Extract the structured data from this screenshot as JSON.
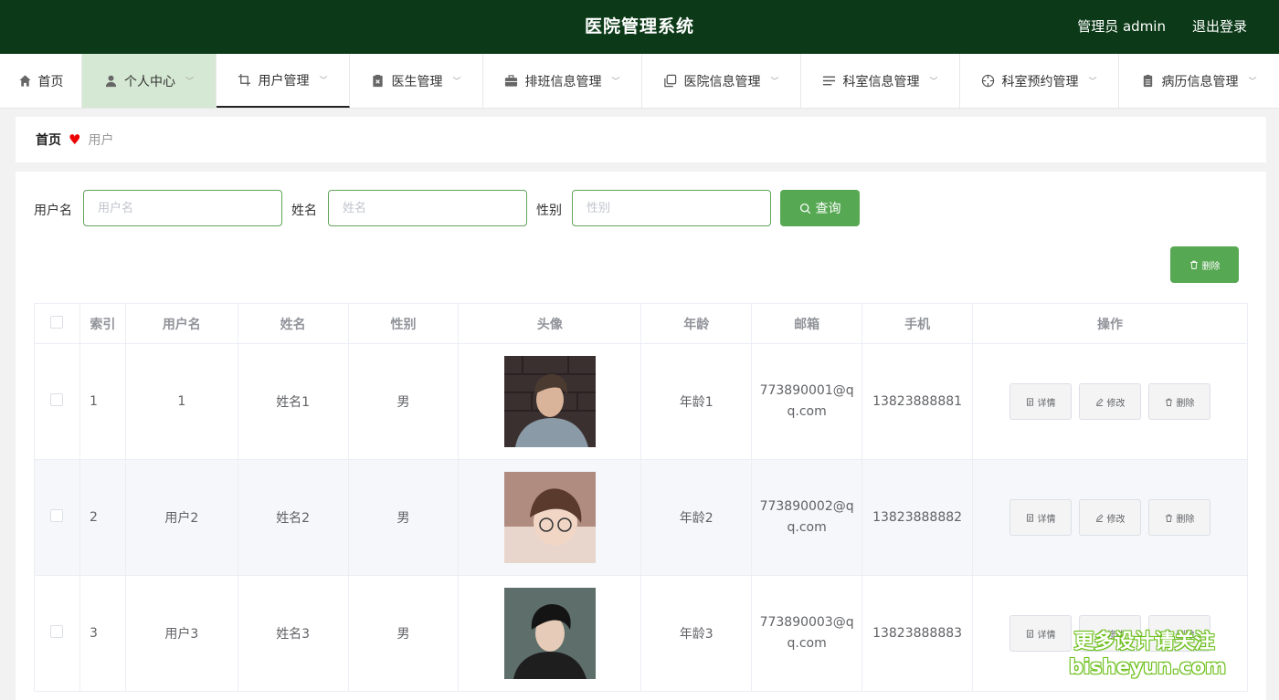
{
  "header": {
    "title": "医院管理系统",
    "user": "管理员 admin",
    "logout": "退出登录"
  },
  "nav": {
    "items": [
      {
        "label": "首页",
        "icon": "home-icon"
      },
      {
        "label": "个人中心",
        "icon": "user-icon"
      },
      {
        "label": "用户管理",
        "icon": "crop-icon"
      },
      {
        "label": "医生管理",
        "icon": "clipboard-x-icon"
      },
      {
        "label": "排班信息管理",
        "icon": "briefcase-icon"
      },
      {
        "label": "医院信息管理",
        "icon": "copy-icon"
      },
      {
        "label": "科室信息管理",
        "icon": "list-icon"
      },
      {
        "label": "科室预约管理",
        "icon": "crosshair-icon"
      },
      {
        "label": "病历信息管理",
        "icon": "document-icon"
      }
    ]
  },
  "breadcrumb": {
    "home": "首页",
    "current": "用户"
  },
  "search": {
    "username_label": "用户名",
    "username_placeholder": "用户名",
    "name_label": "姓名",
    "name_placeholder": "姓名",
    "gender_label": "性别",
    "gender_placeholder": "性别",
    "query_button": "查询"
  },
  "actions": {
    "delete_button": "删除"
  },
  "table": {
    "headers": [
      "索引",
      "用户名",
      "姓名",
      "性别",
      "头像",
      "年龄",
      "邮箱",
      "手机",
      "操作"
    ],
    "rows": [
      {
        "index": "1",
        "username": "1",
        "name": "姓名1",
        "gender": "男",
        "age": "年龄1",
        "email_a": "773890001@q",
        "email_b": "q.com",
        "phone": "13823888881"
      },
      {
        "index": "2",
        "username": "用户2",
        "name": "姓名2",
        "gender": "男",
        "age": "年龄2",
        "email_a": "773890002@q",
        "email_b": "q.com",
        "phone": "13823888882"
      },
      {
        "index": "3",
        "username": "用户3",
        "name": "姓名3",
        "gender": "男",
        "age": "年龄3",
        "email_a": "773890003@q",
        "email_b": "q.com",
        "phone": "13823888883"
      }
    ],
    "row_actions": {
      "detail": "详情",
      "edit": "修改",
      "delete": "删除"
    }
  },
  "watermark": {
    "line1": "更多设计请关注",
    "line2": "bisheyun.com"
  },
  "colors": {
    "header_bg": "#0c3a18",
    "accent": "#57a853",
    "active_nav": "#d5e8d3",
    "heart": "#e00000"
  }
}
